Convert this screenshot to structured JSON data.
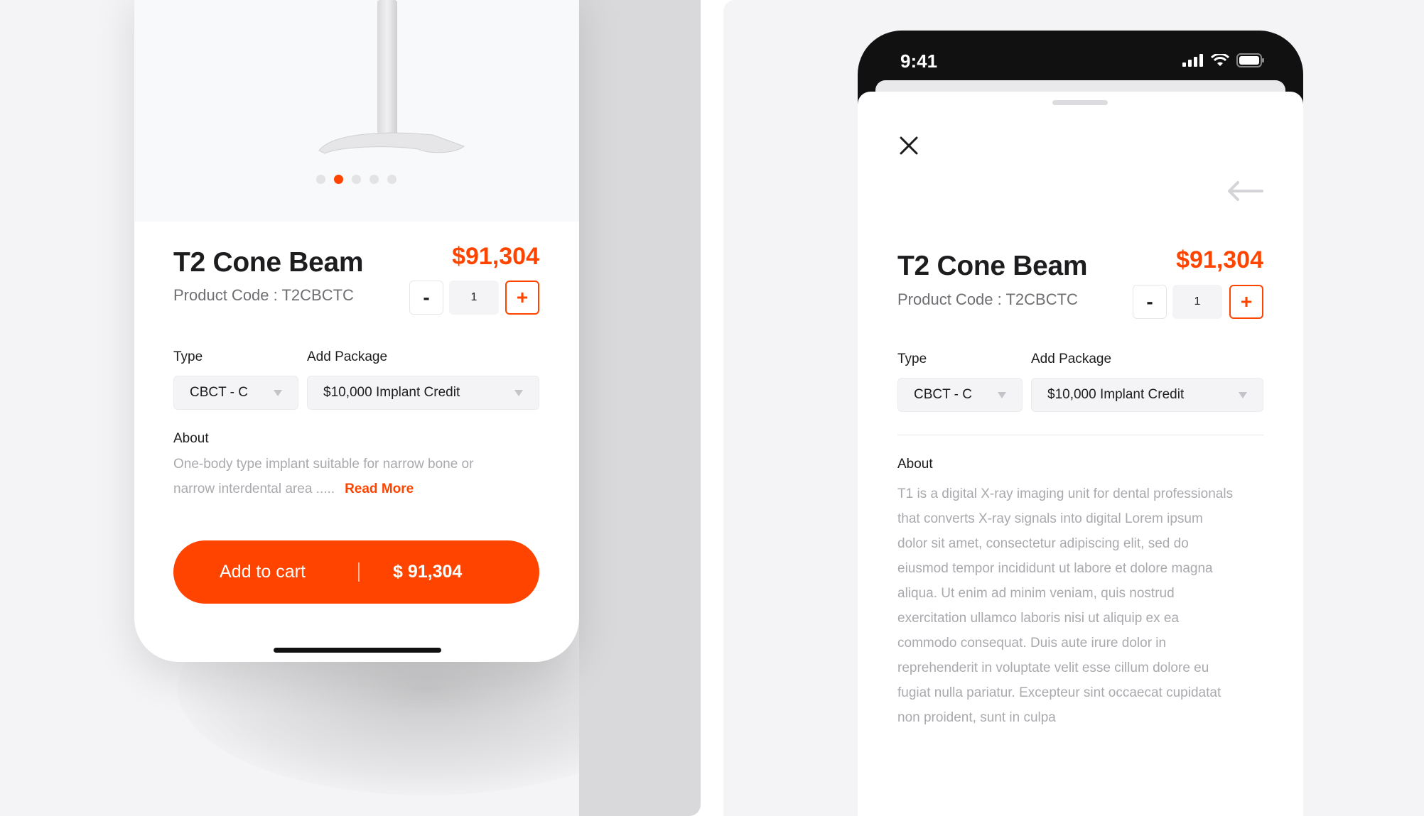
{
  "left": {
    "carousel": {
      "count": 5,
      "active_index": 1
    },
    "product": {
      "title": "T2 Cone Beam",
      "price": "$91,304",
      "code": "Product Code : T2CBCTC",
      "quantity": "1",
      "minus_label": "-",
      "plus_label": "+"
    },
    "type": {
      "label": "Type",
      "value": "CBCT - C"
    },
    "package": {
      "label": "Add Package",
      "value": "$10,000 Implant Credit"
    },
    "about": {
      "label": "About",
      "text_line1": "One-body type implant suitable for narrow bone or",
      "text_line2": "narrow interdental area .....",
      "read_more": "Read More"
    },
    "cart": {
      "label": "Add to cart",
      "price": "$ 91,304"
    }
  },
  "right": {
    "status": {
      "time": "9:41"
    },
    "product": {
      "title": "T2 Cone Beam",
      "price": "$91,304",
      "code": "Product Code : T2CBCTC",
      "quantity": "1",
      "minus_label": "-",
      "plus_label": "+"
    },
    "type": {
      "label": "Type",
      "value": "CBCT - C"
    },
    "package": {
      "label": "Add Package",
      "value": "$10,000 Implant Credit"
    },
    "about": {
      "label": "About",
      "lines": [
        "T1 is a digital X-ray imaging unit for dental professionals",
        "that converts X-ray signals into digital Lorem ipsum",
        "dolor sit amet, consectetur adipiscing elit, sed do",
        "eiusmod tempor incididunt ut labore et dolore magna",
        "aliqua. Ut enim ad minim veniam, quis nostrud",
        "exercitation ullamco laboris nisi ut aliquip ex ea",
        "commodo consequat. Duis aute irure dolor in",
        "reprehenderit in voluptate velit esse cillum dolore eu",
        "fugiat nulla pariatur. Excepteur sint occaecat cupidatat",
        "non proident, sunt in culpa"
      ]
    }
  },
  "colors": {
    "accent": "#ff4400",
    "text": "#1d1d1f",
    "muted": "#a9a9ae"
  },
  "icons": [
    "close-icon",
    "arrow-left-icon",
    "signal-icon",
    "wifi-icon",
    "battery-icon",
    "caret-down-icon"
  ]
}
